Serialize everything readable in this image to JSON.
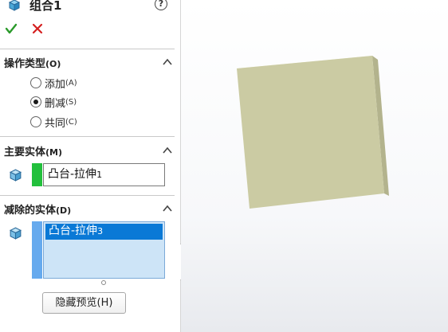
{
  "title": "组合1",
  "help_icon": "?",
  "sections": {
    "operation": {
      "title": "操作类型",
      "key": "(O)",
      "options": [
        {
          "label": "添加",
          "key": "(A)",
          "checked": false
        },
        {
          "label": "删减",
          "key": "(S)",
          "checked": true
        },
        {
          "label": "共同",
          "key": "(C)",
          "checked": false
        }
      ]
    },
    "main_body": {
      "title": "主要实体",
      "key": "(M)",
      "value": "凸台-拉伸",
      "value_sub": "1",
      "swatch_color": "#22c03c"
    },
    "subtract_bodies": {
      "title": "减除的实体",
      "key": "(D)",
      "items": [
        {
          "label": "凸台-拉伸",
          "sub": "3"
        }
      ],
      "swatch_color": "#66aaee"
    }
  },
  "buttons": {
    "hide_preview": "隐藏预览(H)"
  },
  "colors": {
    "ok": "#2a9a2a",
    "cancel": "#d42020",
    "model_face": "#cbcba3",
    "model_top_edge": "#f2f2c9",
    "model_side_edge": "#b3b38d"
  }
}
